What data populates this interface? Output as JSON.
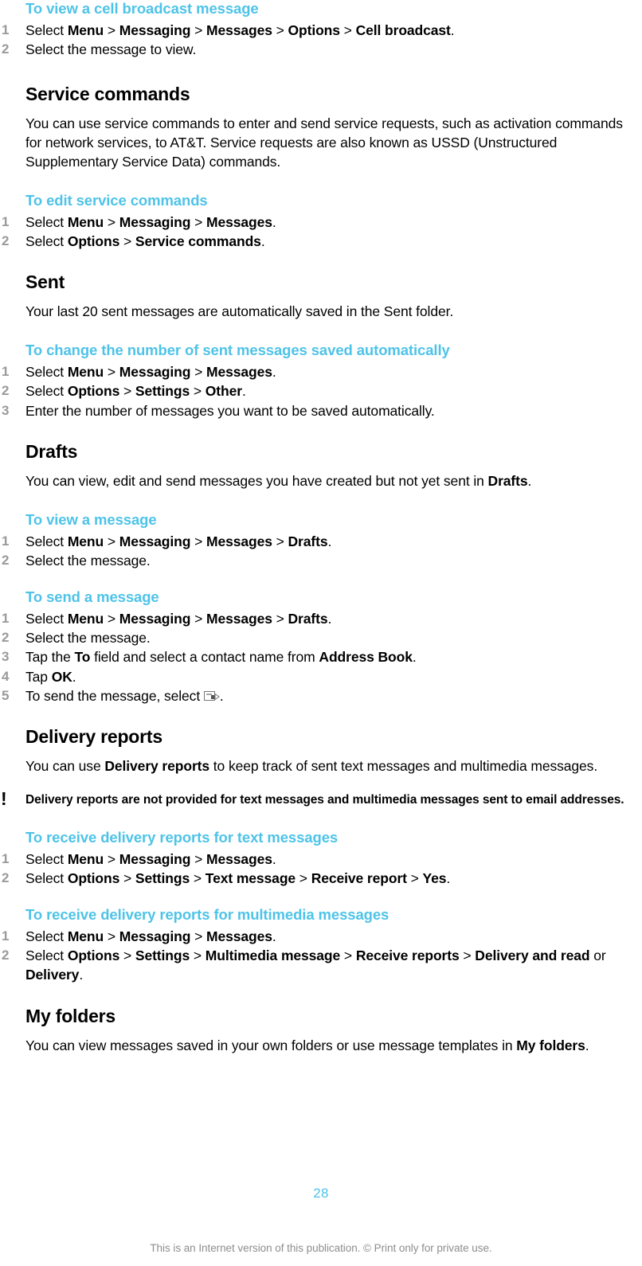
{
  "page": {
    "number": "28",
    "footer_note": "This is an Internet version of this publication. © Print only for private use.",
    "accent_color": "#4EC3E8",
    "step_number_color": "#9A9A9A",
    "footer_color": "#8D8D8D"
  },
  "blocks": {
    "cell_broadcast": {
      "heading": "To view a cell broadcast message",
      "steps": [
        {
          "num": "1",
          "parts": [
            {
              "t": "Select ",
              "b": false
            },
            {
              "t": "Menu",
              "b": true
            },
            {
              "t": " > ",
              "b": false
            },
            {
              "t": "Messaging",
              "b": true
            },
            {
              "t": " > ",
              "b": false
            },
            {
              "t": "Messages",
              "b": true
            },
            {
              "t": " > ",
              "b": false
            },
            {
              "t": "Options",
              "b": true
            },
            {
              "t": " > ",
              "b": false
            },
            {
              "t": "Cell broadcast",
              "b": true
            },
            {
              "t": ".",
              "b": false
            }
          ]
        },
        {
          "num": "2",
          "parts": [
            {
              "t": "Select the message to view.",
              "b": false
            }
          ]
        }
      ]
    },
    "service_commands": {
      "heading": "Service commands",
      "body": "You can use service commands to enter and send service requests, such as activation commands for network services, to AT&T. Service requests are also known as USSD (Unstructured Supplementary Service Data) commands.",
      "task": {
        "heading": "To edit service commands",
        "steps": [
          {
            "num": "1",
            "parts": [
              {
                "t": "Select ",
                "b": false
              },
              {
                "t": "Menu",
                "b": true
              },
              {
                "t": " > ",
                "b": false
              },
              {
                "t": "Messaging",
                "b": true
              },
              {
                "t": " > ",
                "b": false
              },
              {
                "t": "Messages",
                "b": true
              },
              {
                "t": ".",
                "b": false
              }
            ]
          },
          {
            "num": "2",
            "parts": [
              {
                "t": "Select ",
                "b": false
              },
              {
                "t": "Options",
                "b": true
              },
              {
                "t": " > ",
                "b": false
              },
              {
                "t": "Service commands",
                "b": true
              },
              {
                "t": ".",
                "b": false
              }
            ]
          }
        ]
      }
    },
    "sent": {
      "heading": "Sent",
      "body": "Your last 20 sent messages are automatically saved in the Sent folder.",
      "task": {
        "heading": "To change the number of sent messages saved automatically",
        "steps": [
          {
            "num": "1",
            "parts": [
              {
                "t": "Select ",
                "b": false
              },
              {
                "t": "Menu",
                "b": true
              },
              {
                "t": " > ",
                "b": false
              },
              {
                "t": "Messaging",
                "b": true
              },
              {
                "t": " > ",
                "b": false
              },
              {
                "t": "Messages",
                "b": true
              },
              {
                "t": ".",
                "b": false
              }
            ]
          },
          {
            "num": "2",
            "parts": [
              {
                "t": "Select ",
                "b": false
              },
              {
                "t": "Options",
                "b": true
              },
              {
                "t": " > ",
                "b": false
              },
              {
                "t": "Settings",
                "b": true
              },
              {
                "t": " > ",
                "b": false
              },
              {
                "t": "Other",
                "b": true
              },
              {
                "t": ".",
                "b": false
              }
            ]
          },
          {
            "num": "3",
            "parts": [
              {
                "t": "Enter the number of messages you want to be saved automatically.",
                "b": false
              }
            ]
          }
        ]
      }
    },
    "drafts": {
      "heading": "Drafts",
      "body_parts": [
        {
          "t": "You can view, edit and send messages you have created but not yet sent in ",
          "b": false
        },
        {
          "t": "Drafts",
          "b": true
        },
        {
          "t": ".",
          "b": false
        }
      ],
      "task_view": {
        "heading": "To view a message",
        "steps": [
          {
            "num": "1",
            "parts": [
              {
                "t": "Select ",
                "b": false
              },
              {
                "t": "Menu",
                "b": true
              },
              {
                "t": " > ",
                "b": false
              },
              {
                "t": "Messaging",
                "b": true
              },
              {
                "t": " > ",
                "b": false
              },
              {
                "t": "Messages",
                "b": true
              },
              {
                "t": " > ",
                "b": false
              },
              {
                "t": "Drafts",
                "b": true
              },
              {
                "t": ".",
                "b": false
              }
            ]
          },
          {
            "num": "2",
            "parts": [
              {
                "t": "Select the message.",
                "b": false
              }
            ]
          }
        ]
      },
      "task_send": {
        "heading": "To send a message",
        "steps": [
          {
            "num": "1",
            "parts": [
              {
                "t": "Select ",
                "b": false
              },
              {
                "t": "Menu",
                "b": true
              },
              {
                "t": " > ",
                "b": false
              },
              {
                "t": "Messaging",
                "b": true
              },
              {
                "t": " > ",
                "b": false
              },
              {
                "t": "Messages",
                "b": true
              },
              {
                "t": " > ",
                "b": false
              },
              {
                "t": "Drafts",
                "b": true
              },
              {
                "t": ".",
                "b": false
              }
            ]
          },
          {
            "num": "2",
            "parts": [
              {
                "t": "Select the message.",
                "b": false
              }
            ]
          },
          {
            "num": "3",
            "parts": [
              {
                "t": "Tap the ",
                "b": false
              },
              {
                "t": "To",
                "b": true
              },
              {
                "t": " field and select a contact name from ",
                "b": false
              },
              {
                "t": "Address Book",
                "b": true
              },
              {
                "t": ".",
                "b": false
              }
            ]
          },
          {
            "num": "4",
            "parts": [
              {
                "t": "Tap ",
                "b": false
              },
              {
                "t": "OK",
                "b": true
              },
              {
                "t": ".",
                "b": false
              }
            ]
          },
          {
            "num": "5",
            "parts": [
              {
                "t": "To send the message, select ",
                "b": false
              },
              {
                "icon": "send-message-icon"
              },
              {
                "t": ".",
                "b": false
              }
            ]
          }
        ]
      }
    },
    "delivery_reports": {
      "heading": "Delivery reports",
      "body_parts": [
        {
          "t": "You can use ",
          "b": false
        },
        {
          "t": "Delivery reports",
          "b": true
        },
        {
          "t": " to keep track of sent text messages and multimedia messages.",
          "b": false
        }
      ],
      "note": {
        "icon": "exclamation-note-icon",
        "text": "Delivery reports are not provided for text messages and multimedia messages sent to email addresses."
      },
      "task_text": {
        "heading": "To receive delivery reports for text messages",
        "steps": [
          {
            "num": "1",
            "parts": [
              {
                "t": "Select ",
                "b": false
              },
              {
                "t": "Menu",
                "b": true
              },
              {
                "t": " > ",
                "b": false
              },
              {
                "t": "Messaging",
                "b": true
              },
              {
                "t": " > ",
                "b": false
              },
              {
                "t": "Messages",
                "b": true
              },
              {
                "t": ".",
                "b": false
              }
            ]
          },
          {
            "num": "2",
            "parts": [
              {
                "t": "Select ",
                "b": false
              },
              {
                "t": "Options",
                "b": true
              },
              {
                "t": " > ",
                "b": false
              },
              {
                "t": "Settings",
                "b": true
              },
              {
                "t": " > ",
                "b": false
              },
              {
                "t": "Text message",
                "b": true
              },
              {
                "t": " > ",
                "b": false
              },
              {
                "t": "Receive report",
                "b": true
              },
              {
                "t": " > ",
                "b": false
              },
              {
                "t": "Yes",
                "b": true
              },
              {
                "t": ".",
                "b": false
              }
            ]
          }
        ]
      },
      "task_mms": {
        "heading": "To receive delivery reports for multimedia messages",
        "steps": [
          {
            "num": "1",
            "parts": [
              {
                "t": "Select ",
                "b": false
              },
              {
                "t": "Menu",
                "b": true
              },
              {
                "t": " > ",
                "b": false
              },
              {
                "t": "Messaging",
                "b": true
              },
              {
                "t": " > ",
                "b": false
              },
              {
                "t": "Messages",
                "b": true
              },
              {
                "t": ".",
                "b": false
              }
            ]
          },
          {
            "num": "2",
            "parts": [
              {
                "t": "Select ",
                "b": false
              },
              {
                "t": "Options",
                "b": true
              },
              {
                "t": " > ",
                "b": false
              },
              {
                "t": "Settings",
                "b": true
              },
              {
                "t": " > ",
                "b": false
              },
              {
                "t": "Multimedia message",
                "b": true
              },
              {
                "t": " > ",
                "b": false
              },
              {
                "t": "Receive reports",
                "b": true
              },
              {
                "t": " > ",
                "b": false
              },
              {
                "t": "Delivery and read",
                "b": true
              },
              {
                "t": " or ",
                "b": false
              },
              {
                "t": "Delivery",
                "b": true
              },
              {
                "t": ".",
                "b": false
              }
            ]
          }
        ]
      }
    },
    "my_folders": {
      "heading": "My folders",
      "body_parts": [
        {
          "t": "You can view messages saved in your own folders or use message templates in ",
          "b": false
        },
        {
          "t": "My folders",
          "b": true
        },
        {
          "t": ".",
          "b": false
        }
      ]
    }
  }
}
